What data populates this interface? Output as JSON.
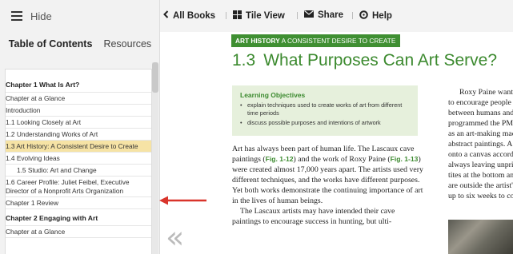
{
  "sidebar": {
    "hide_label": "Hide",
    "tabs": {
      "toc": "Table of Contents",
      "resources": "Resources"
    },
    "toc_items": [
      {
        "label": "Chapter 1 What Is Art?",
        "kind": "chapter"
      },
      {
        "label": "Chapter at a Glance",
        "kind": "item"
      },
      {
        "label": "Introduction",
        "kind": "item"
      },
      {
        "label": "1.1 Looking Closely at Art",
        "kind": "item"
      },
      {
        "label": "1.2 Understanding Works of Art",
        "kind": "item"
      },
      {
        "label": "1.3 Art History: A Consistent Desire to Create",
        "kind": "item",
        "active": true
      },
      {
        "label": "1.4 Evolving Ideas",
        "kind": "item"
      },
      {
        "label": "1.5 Studio: Art and Change",
        "kind": "sub"
      },
      {
        "label": "1.6 Career Profile: Juliet Feibel, Executive Director of a Nonprofit Arts Organization",
        "kind": "item"
      },
      {
        "label": "Chapter 1 Review",
        "kind": "item"
      },
      {
        "label": "Chapter 2 Engaging with Art",
        "kind": "chapter"
      },
      {
        "label": "Chapter at a Glance",
        "kind": "item"
      }
    ],
    "active_highlight_color": "#f6e3a5"
  },
  "toolbar": {
    "all_books": "All Books",
    "tile_view": "Tile View",
    "share": "Share",
    "help": "Help"
  },
  "section": {
    "banner_label": "ART HISTORY",
    "banner_subtitle": "A CONSISTENT DESIRE TO CREATE",
    "number": "1.3",
    "title": "What Purposes Can Art Serve?",
    "accent_color": "#3c8a2f"
  },
  "objectives": {
    "heading": "Learning Objectives",
    "items": [
      "explain techniques used to create works of art from different time periods",
      "discuss possible purposes and intentions of artwork"
    ]
  },
  "body": {
    "col1_p1_a": "Art has always been part of human life. The Lascaux cave paintings (",
    "fig1": "Fig. 1-12",
    "col1_p1_b": ") and the work of Roxy Paine (",
    "fig2": "Fig. 1-13",
    "col1_p1_c": ") were created almost 17,000 years apart. The artists used very different techniques, and the works have different purposes. Yet both works demonstrate the continuing importance of art in the lives of human beings.",
    "col1_p2": "The Lascaux artists may have intended their cave paintings to encourage success in hunting, but ulti-",
    "col2_lines": [
      "Roxy Paine wants h",
      "to encourage people to",
      "between humans and",
      "programmed the PMU",
      "as an art-making mac",
      "abstract paintings. A r",
      "onto a canvas accordi",
      "always leaving unprin",
      "tites at the bottom and",
      "are outside the artist's",
      "up to six weeks to com"
    ]
  }
}
